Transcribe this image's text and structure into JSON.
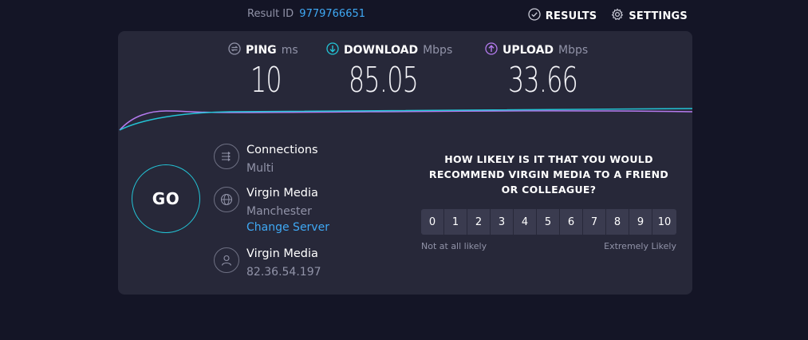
{
  "header": {
    "result_label": "Result ID",
    "result_id": "9779766651",
    "nav": [
      {
        "label": "RESULTS",
        "icon": "check-circle-icon"
      },
      {
        "label": "SETTINGS",
        "icon": "gear-icon"
      }
    ]
  },
  "metrics": {
    "ping": {
      "label": "PING",
      "unit": "ms",
      "value": "10",
      "icon": "ping-icon",
      "color": "#9193a8"
    },
    "download": {
      "label": "DOWNLOAD",
      "unit": "Mbps",
      "value": "85.05",
      "icon": "download-arrow-icon",
      "color": "#23c4d6"
    },
    "upload": {
      "label": "UPLOAD",
      "unit": "Mbps",
      "value": "33.66",
      "icon": "upload-arrow-icon",
      "color": "#b57bf0"
    }
  },
  "go_button": {
    "label": "GO"
  },
  "info": {
    "connections": {
      "title": "Connections",
      "value": "Multi",
      "icon": "connections-icon"
    },
    "server": {
      "title": "Virgin Media",
      "location": "Manchester",
      "change_link": "Change Server",
      "icon": "globe-icon"
    },
    "isp": {
      "title": "Virgin Media",
      "ip": "82.36.54.197",
      "icon": "user-icon"
    }
  },
  "survey": {
    "question": "HOW LIKELY IS IT THAT YOU WOULD RECOMMEND VIRGIN MEDIA TO A FRIEND OR COLLEAGUE?",
    "options": [
      "0",
      "1",
      "2",
      "3",
      "4",
      "5",
      "6",
      "7",
      "8",
      "9",
      "10"
    ],
    "low_label": "Not at all likely",
    "high_label": "Extremely Likely"
  },
  "colors": {
    "background": "#141526",
    "card": "#272839",
    "accent_cyan": "#23c4d6",
    "accent_purple": "#b57bf0",
    "link": "#3fa9f5"
  }
}
